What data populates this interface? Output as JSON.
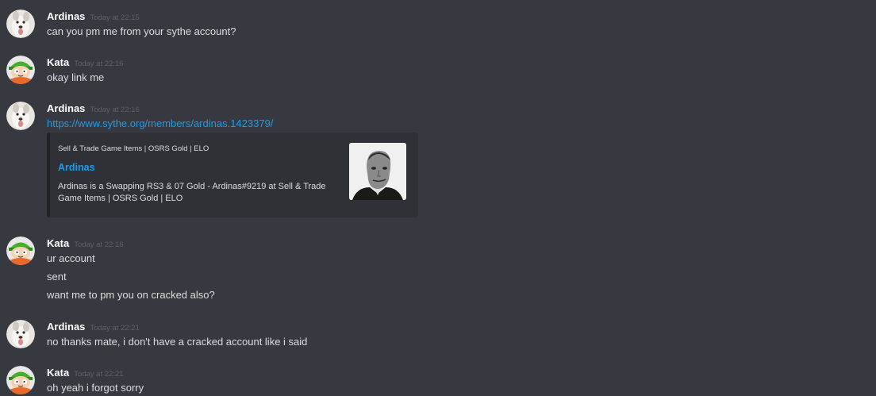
{
  "messages": [
    {
      "author": "Ardinas",
      "avatar": "dog-avatar-icon",
      "timestamp": "Today at 22:15",
      "lines": [
        "can you pm me from your sythe account?"
      ]
    },
    {
      "author": "Kata",
      "avatar": "kyle-avatar-icon",
      "timestamp": "Today at 22:16",
      "lines": [
        "okay link me"
      ]
    },
    {
      "author": "Ardinas",
      "avatar": "dog-avatar-icon",
      "timestamp": "Today at 22:16",
      "link": "https://www.sythe.org/members/ardinas.1423379/",
      "embed": {
        "provider": "Sell & Trade Game Items | OSRS Gold | ELO",
        "title": "Ardinas",
        "description": "Ardinas is a Swapping RS3 & 07 Gold - Ardinas#9219 at Sell & Trade Game Items | OSRS Gold | ELO",
        "thumbnail": "profile-photo-thumbnail"
      }
    },
    {
      "author": "Kata",
      "avatar": "kyle-avatar-icon",
      "timestamp": "Today at 22:16",
      "lines": [
        "ur account",
        "sent",
        "want me to pm you on cracked also?"
      ]
    },
    {
      "author": "Ardinas",
      "avatar": "dog-avatar-icon",
      "timestamp": "Today at 22:21",
      "lines": [
        "no thanks mate, i don't have a cracked account like i said"
      ]
    },
    {
      "author": "Kata",
      "avatar": "kyle-avatar-icon",
      "timestamp": "Today at 22:21",
      "lines": [
        "oh yeah i forgot sorry"
      ]
    }
  ],
  "colors": {
    "background": "#36393f",
    "embed_background": "#2f3136",
    "link": "#1f9ce8",
    "username": "#ffffff",
    "timestamp": "#5e6168",
    "text": "#dcddde"
  }
}
